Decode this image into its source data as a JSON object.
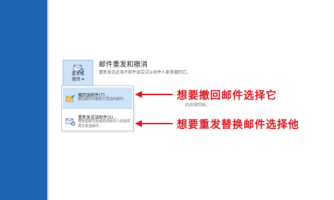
{
  "ribbon": {
    "button_line1": "重发或",
    "button_line2": "撤回 ▾"
  },
  "section": {
    "title": "邮件重发和撤消",
    "description": "重新发送此电子邮件或尝试从收件人那里撤回它。"
  },
  "background_text": "的阅读回执。",
  "dropdown": {
    "items": [
      {
        "title": "撤回该邮件(T)...",
        "description": "撤回邮件并删除已发送的邮件。"
      },
      {
        "title": "重新发送该邮件(S)...",
        "description": "使用更新内容或更改收件人的选项再次发送邮件。"
      }
    ]
  },
  "annotations": {
    "recall": "想要撤回邮件选择它",
    "resend": "想要重发替换邮件选择他",
    "color": "#d8141e"
  },
  "colors": {
    "sidebar": "#1e64b4",
    "highlight": "#cde3f8"
  }
}
